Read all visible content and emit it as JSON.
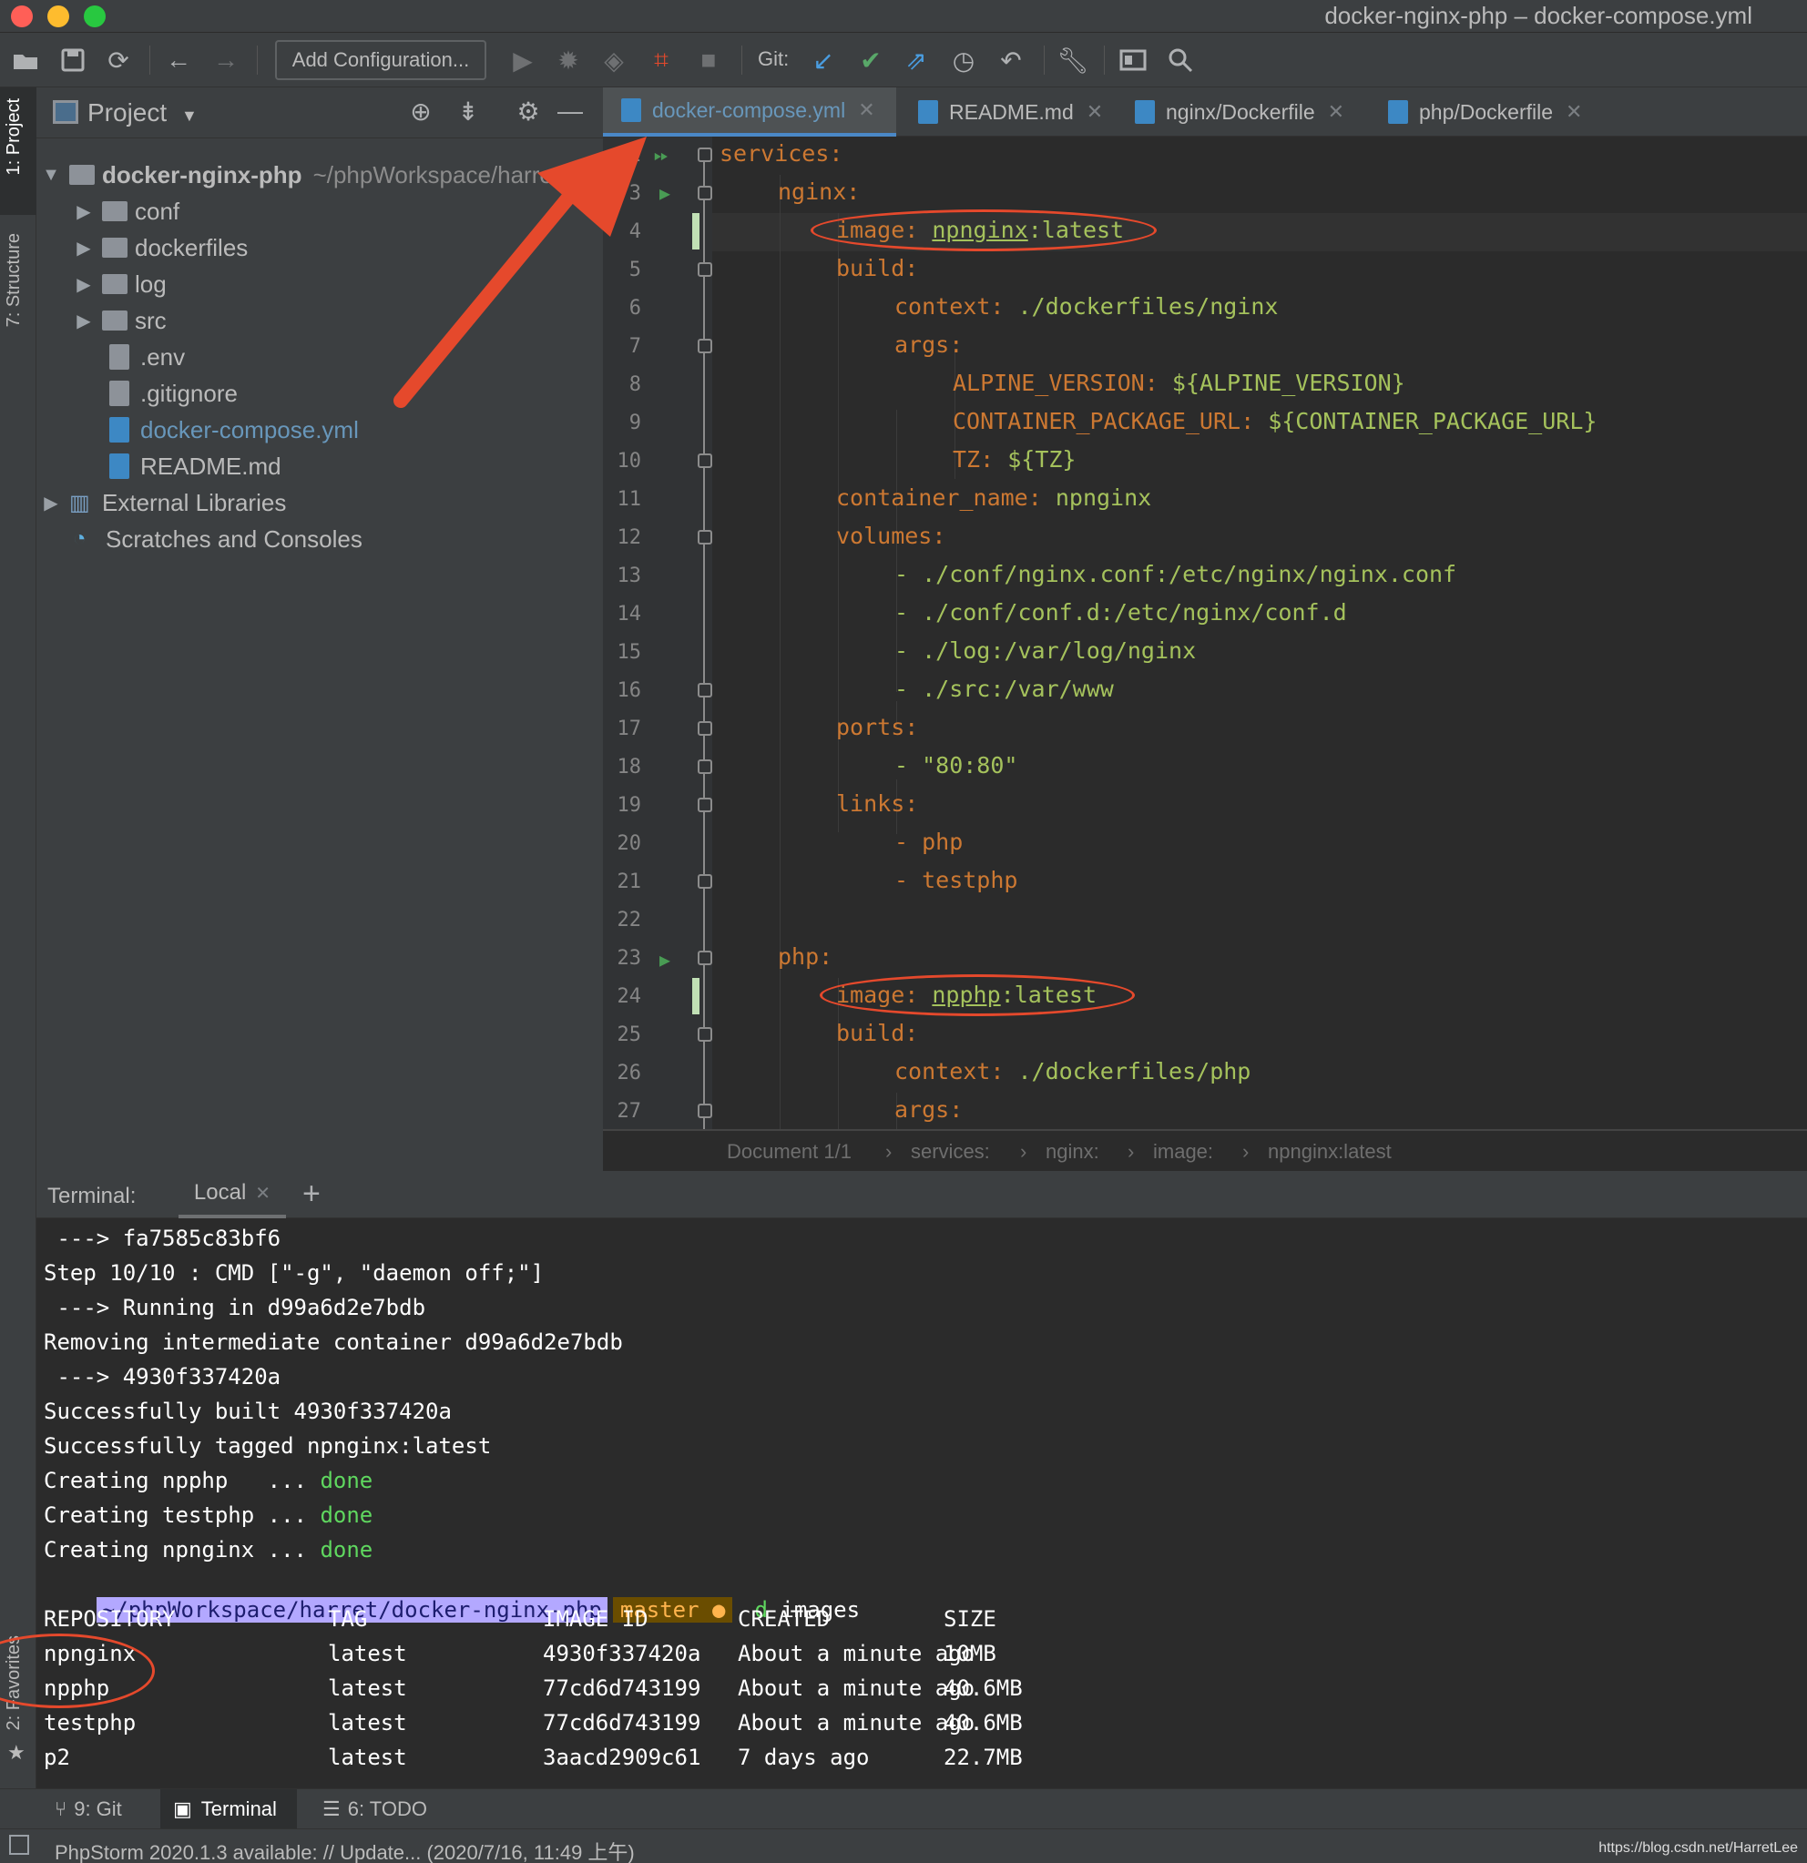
{
  "window": {
    "title": "docker-nginx-php – docker-compose.yml"
  },
  "toolbar": {
    "add_config_label": "Add Configuration...",
    "git_label": "Git:"
  },
  "left_stripe": {
    "project_tab": "1: Project",
    "structure_tab": "7: Structure",
    "favorites_tab": "2: Favorites"
  },
  "project_panel": {
    "title": "Project",
    "root": {
      "name": "docker-nginx-php",
      "path": "~/phpWorkspace/harret"
    },
    "items": [
      {
        "label": "conf"
      },
      {
        "label": "dockerfiles"
      },
      {
        "label": "log"
      },
      {
        "label": "src"
      },
      {
        "label": ".env"
      },
      {
        "label": ".gitignore"
      },
      {
        "label": "docker-compose.yml"
      },
      {
        "label": "README.md"
      },
      {
        "label": "External Libraries"
      },
      {
        "label": "Scratches and Consoles"
      }
    ]
  },
  "editor": {
    "tabs": [
      {
        "label": "docker-compose.yml"
      },
      {
        "label": "README.md"
      },
      {
        "label": "nginx/Dockerfile"
      },
      {
        "label": "php/Dockerfile"
      }
    ],
    "line_numbers": [
      "2",
      "3",
      "4",
      "5",
      "6",
      "7",
      "8",
      "9",
      "10",
      "11",
      "12",
      "13",
      "14",
      "15",
      "16",
      "17",
      "18",
      "19",
      "20",
      "21",
      "22",
      "23",
      "24",
      "25",
      "26",
      "27"
    ],
    "code": {
      "l2": "services:",
      "l3": "nginx:",
      "l4_key": "image:",
      "l4_name": "npnginx",
      "l4_tag": ":latest",
      "l5": "build:",
      "l6_key": "context:",
      "l6_val": "./dockerfiles/nginx",
      "l7": "args:",
      "l8_key": "ALPINE_VERSION:",
      "l8_val": "${ALPINE_VERSION}",
      "l9_key": "CONTAINER_PACKAGE_URL:",
      "l9_val": "${CONTAINER_PACKAGE_URL}",
      "l10_key": "TZ:",
      "l10_val": "${TZ}",
      "l11_key": "container_name:",
      "l11_val": "npnginx",
      "l12": "volumes:",
      "l13": "- ./conf/nginx.conf:/etc/nginx/nginx.conf",
      "l14": "- ./conf/conf.d:/etc/nginx/conf.d",
      "l15": "- ./log:/var/log/nginx",
      "l16": "- ./src:/var/www",
      "l17": "ports:",
      "l18": "- \"80:80\"",
      "l19": "links:",
      "l20": "- php",
      "l21": "- testphp",
      "l23": "php:",
      "l24_key": "image:",
      "l24_name": "npphp",
      "l24_tag": ":latest",
      "l25": "build:",
      "l26_key": "context:",
      "l26_val": "./dockerfiles/php",
      "l27": "args:"
    },
    "breadcrumb": [
      "Document 1/1",
      "services:",
      "nginx:",
      "image:",
      "npnginx:latest"
    ]
  },
  "terminal": {
    "label": "Terminal:",
    "tab": "Local",
    "lines": [
      " ---> fa7585c83bf6",
      "Step 10/10 : CMD [\"-g\", \"daemon off;\"]",
      " ---> Running in d99a6d2e7bdb",
      "Removing intermediate container d99a6d2e7bdb",
      " ---> 4930f337420a",
      "Successfully built 4930f337420a",
      "Successfully tagged npnginx:latest"
    ],
    "creating": [
      {
        "text": "Creating npphp   ... ",
        "status": "done"
      },
      {
        "text": "Creating testphp ... ",
        "status": "done"
      },
      {
        "text": "Creating npnginx ... ",
        "status": "done"
      }
    ],
    "prompt": {
      "path": "~/phpWorkspace/harret/docker-nginx-php",
      "branch": "master ●",
      "command": "d images"
    },
    "table_headers": [
      "REPOSITORY",
      "TAG",
      "IMAGE ID",
      "CREATED",
      "SIZE"
    ],
    "table_rows": [
      [
        "npnginx",
        "latest",
        "4930f337420a",
        "About a minute ago",
        "10MB"
      ],
      [
        "npphp",
        "latest",
        "77cd6d743199",
        "About a minute ago",
        "40.6MB"
      ],
      [
        "testphp",
        "latest",
        "77cd6d743199",
        "About a minute ago",
        "40.6MB"
      ],
      [
        "p2",
        "latest",
        "3aacd2909c61",
        "7 days ago",
        "22.7MB"
      ]
    ]
  },
  "bottom_tools": {
    "git": "9: Git",
    "terminal": "Terminal",
    "todo": "6: TODO"
  },
  "statusbar": {
    "message": "PhpStorm 2020.1.3 available: // Update... (2020/7/16, 11:49 上午)",
    "watermark": "https://blog.csdn.net/HarretLee"
  },
  "colors": {
    "annotation": "#e5492c",
    "accent": "#4a88c7",
    "yaml_key": "#cc7832",
    "yaml_value": "#a5c25c"
  }
}
